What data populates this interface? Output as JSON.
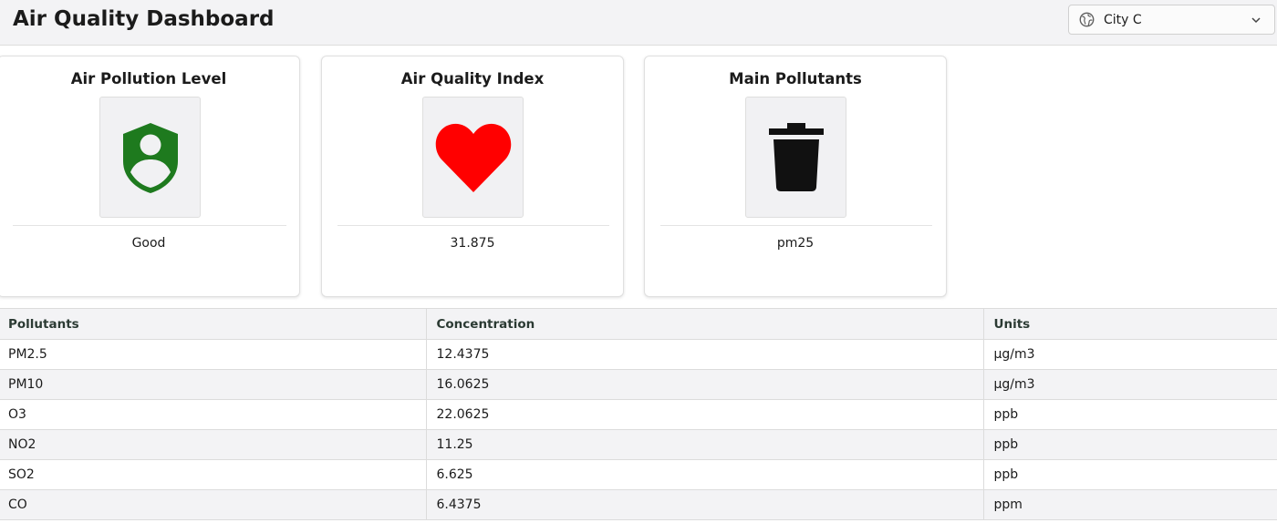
{
  "header": {
    "title": "Air Quality Dashboard",
    "city_select": {
      "value": "City C",
      "icon": "globe-icon"
    }
  },
  "cards": [
    {
      "title": "Air Pollution Level",
      "value": "Good",
      "icon": "shield-person-icon",
      "icon_color": "#1e7a1e"
    },
    {
      "title": "Air Quality Index",
      "value": "31.875",
      "icon": "heart-icon",
      "icon_color": "#ff0000"
    },
    {
      "title": "Main Pollutants",
      "value": "pm25",
      "icon": "trash-icon",
      "icon_color": "#111111"
    }
  ],
  "table": {
    "columns": [
      "Pollutants",
      "Concentration",
      "Units"
    ],
    "rows": [
      [
        "PM2.5",
        "12.4375",
        "µg/m3"
      ],
      [
        "PM10",
        "16.0625",
        "µg/m3"
      ],
      [
        "O3",
        "22.0625",
        "ppb"
      ],
      [
        "NO2",
        "11.25",
        "ppb"
      ],
      [
        "SO2",
        "6.625",
        "ppb"
      ],
      [
        "CO",
        "6.4375",
        "ppm"
      ]
    ]
  }
}
